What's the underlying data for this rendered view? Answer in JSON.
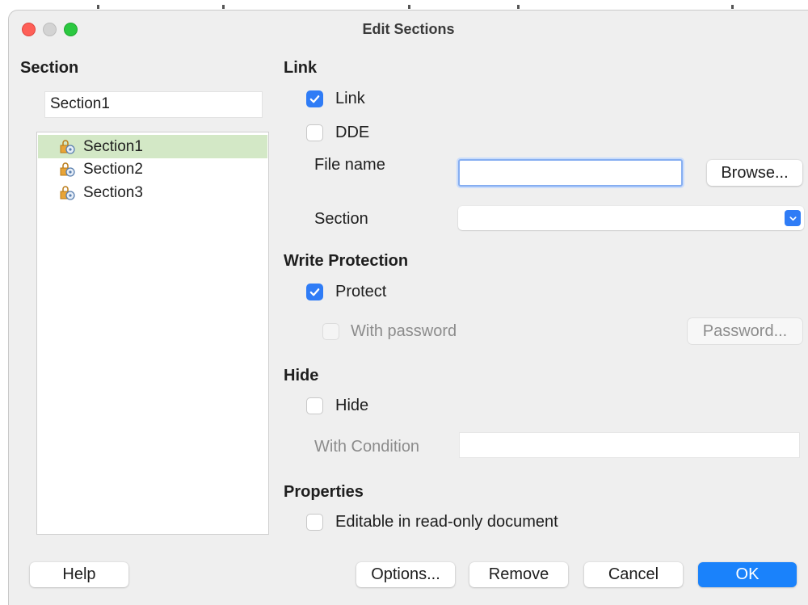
{
  "window": {
    "title": "Edit Sections"
  },
  "section_panel": {
    "heading": "Section",
    "name_value": "Section1",
    "items": [
      {
        "label": "Section1",
        "selected": true
      },
      {
        "label": "Section2",
        "selected": false
      },
      {
        "label": "Section3",
        "selected": false
      }
    ]
  },
  "link": {
    "heading": "Link",
    "link_checkbox": {
      "label": "Link",
      "checked": true
    },
    "dde_checkbox": {
      "label": "DDE",
      "checked": false
    },
    "file_name_label": "File name",
    "file_name_value": "",
    "browse_button": "Browse...",
    "section_label": "Section",
    "section_value": ""
  },
  "write_protection": {
    "heading": "Write Protection",
    "protect_checkbox": {
      "label": "Protect",
      "checked": true
    },
    "with_password_checkbox": {
      "label": "With password",
      "checked": false,
      "enabled": false
    },
    "password_button": "Password..."
  },
  "hide": {
    "heading": "Hide",
    "hide_checkbox": {
      "label": "Hide",
      "checked": false
    },
    "with_condition_label": "With Condition",
    "with_condition_value": ""
  },
  "properties": {
    "heading": "Properties",
    "editable_checkbox": {
      "label": "Editable in read-only document",
      "checked": false
    }
  },
  "buttons": {
    "help": "Help",
    "options": "Options...",
    "remove": "Remove",
    "cancel": "Cancel",
    "ok": "OK"
  },
  "colors": {
    "accent": "#2f7cf6",
    "ok_button": "#1a82fb",
    "selection": "#d3e8c6"
  }
}
